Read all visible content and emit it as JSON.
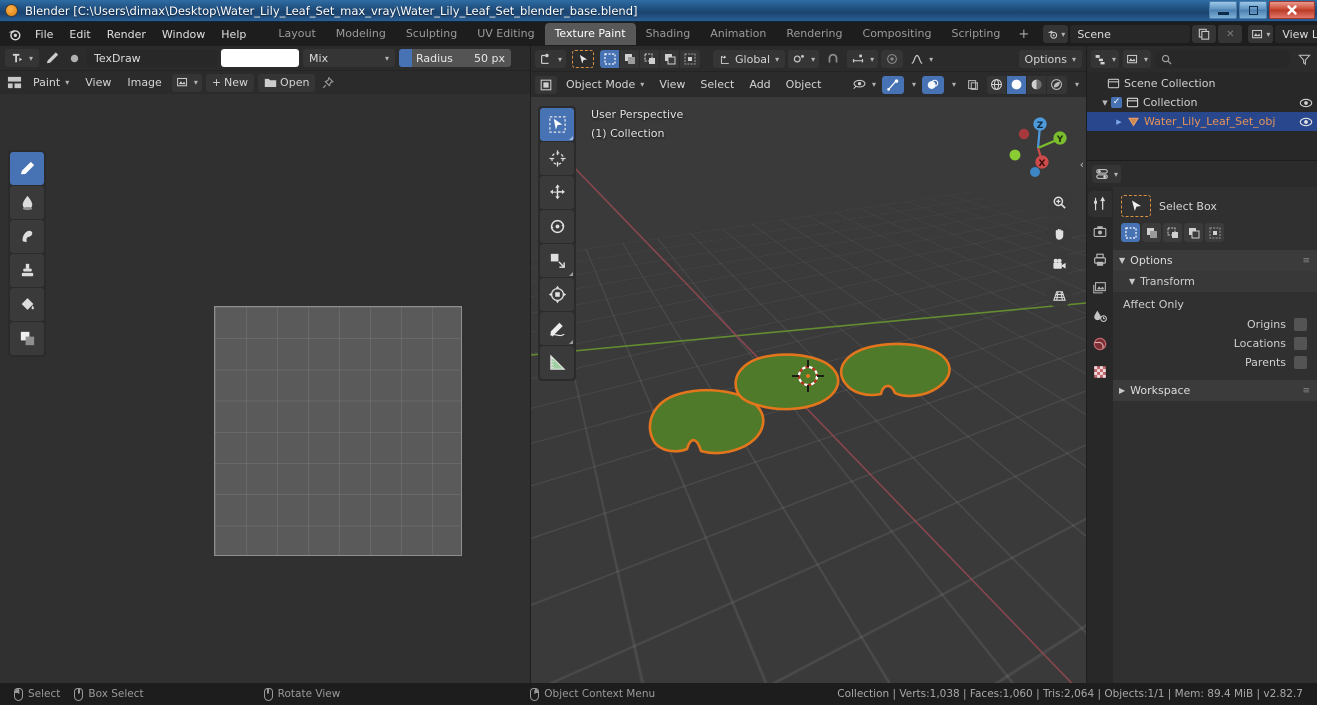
{
  "window": {
    "title": "Blender [C:\\Users\\dimax\\Desktop\\Water_Lily_Leaf_Set_max_vray\\Water_Lily_Leaf_Set_blender_base.blend]",
    "minimize": "—",
    "restore": "❐",
    "close": "✕"
  },
  "topbar": {
    "menus": [
      "File",
      "Edit",
      "Render",
      "Window",
      "Help"
    ],
    "workspaces": [
      "Layout",
      "Modeling",
      "Sculpting",
      "UV Editing",
      "Texture Paint",
      "Shading",
      "Animation",
      "Rendering",
      "Compositing",
      "Scripting"
    ],
    "active_workspace": "Texture Paint",
    "add_workspace": "+",
    "scene_name": "Scene",
    "view_layer_name": "View Layer"
  },
  "image_editor": {
    "mode": "Paint",
    "menus": [
      "View",
      "Image"
    ],
    "brush_name": "TexDraw",
    "color": "#ffffff",
    "blend_mode": "Mix",
    "radius_label": "Radius",
    "radius_value": "50 px",
    "new_button": "New",
    "open_button": "Open",
    "add_button": "+",
    "tools": [
      {
        "name": "draw",
        "active": true
      },
      {
        "name": "soften",
        "active": false
      },
      {
        "name": "smear",
        "active": false
      },
      {
        "name": "clone",
        "active": false
      },
      {
        "name": "fill",
        "active": false
      },
      {
        "name": "mask",
        "active": false
      }
    ]
  },
  "viewport": {
    "mode": "Object Mode",
    "menus": [
      "View",
      "Select",
      "Add",
      "Object"
    ],
    "transform_orientation": "Global",
    "options_label": "Options",
    "overlay_line1": "User Perspective",
    "overlay_line2": "(1) Collection",
    "gizmo_axes": [
      "X",
      "Y",
      "Z"
    ],
    "tools": [
      {
        "name": "select-box",
        "active": true
      },
      {
        "name": "cursor",
        "active": false
      },
      {
        "name": "move",
        "active": false
      },
      {
        "name": "rotate",
        "active": false
      },
      {
        "name": "scale",
        "active": false
      },
      {
        "name": "transform",
        "active": false
      },
      {
        "name": "annotate",
        "active": false
      },
      {
        "name": "measure",
        "active": false
      }
    ],
    "nav_buttons": [
      "zoom-icon",
      "pan-hand-icon",
      "camera-icon",
      "perspective-grid-icon"
    ],
    "shading_modes": [
      "wireframe",
      "solid",
      "material-preview",
      "rendered"
    ],
    "active_shading": "solid",
    "colors": {
      "leaf_fill": "#4f7a2a",
      "leaf_outline": "#e3761c",
      "x_axis": "#9b4a55",
      "y_axis": "#6c9b2f",
      "background": "#3a3a3a"
    }
  },
  "outliner": {
    "search_placeholder": "",
    "rows": [
      {
        "label": "Scene Collection",
        "indent": 6,
        "icon": "collection-icon",
        "selected": false,
        "has_disclosure": false,
        "has_checkbox": false,
        "has_eye": false
      },
      {
        "label": "Collection",
        "indent": 16,
        "icon": "collection-icon",
        "selected": false,
        "has_disclosure": true,
        "has_checkbox": true,
        "has_eye": true
      },
      {
        "label": "Water_Lily_Leaf_Set_obj",
        "indent": 30,
        "icon": "mesh-data-icon",
        "selected": true,
        "has_disclosure": true,
        "has_checkbox": false,
        "has_eye": true
      }
    ]
  },
  "properties": {
    "tabs": [
      "tool-icon",
      "render-icon",
      "output-icon",
      "view-layer-icon",
      "scene-icon",
      "world-icon",
      "texture-icon"
    ],
    "active_tab": "tool-icon",
    "active_tool": "Select Box",
    "select_modes": [
      "set",
      "extend",
      "subtract",
      "invert",
      "intersect"
    ],
    "active_select_mode": "set",
    "panels": [
      {
        "title": "Options",
        "expanded": true
      },
      {
        "title": "Transform",
        "expanded": true,
        "sub": true
      }
    ],
    "affect_only_label": "Affect Only",
    "affect_only": [
      {
        "label": "Origins",
        "checked": false
      },
      {
        "label": "Locations",
        "checked": false
      },
      {
        "label": "Parents",
        "checked": false
      }
    ],
    "workspace_panel": "Workspace"
  },
  "statusbar": {
    "hints": [
      {
        "icon": "mouse-left-icon",
        "label": "Select"
      },
      {
        "icon": "mouse-middle-icon",
        "label": "Box Select"
      },
      {
        "icon": "mouse-middle-icon",
        "label": "Rotate View"
      },
      {
        "icon": "mouse-right-icon",
        "label": "Object Context Menu"
      }
    ],
    "stats": "Collection | Verts:1,038 | Faces:1,060 | Tris:2,064 | Objects:1/1 | Mem: 89.4 MiB | v2.82.7"
  }
}
